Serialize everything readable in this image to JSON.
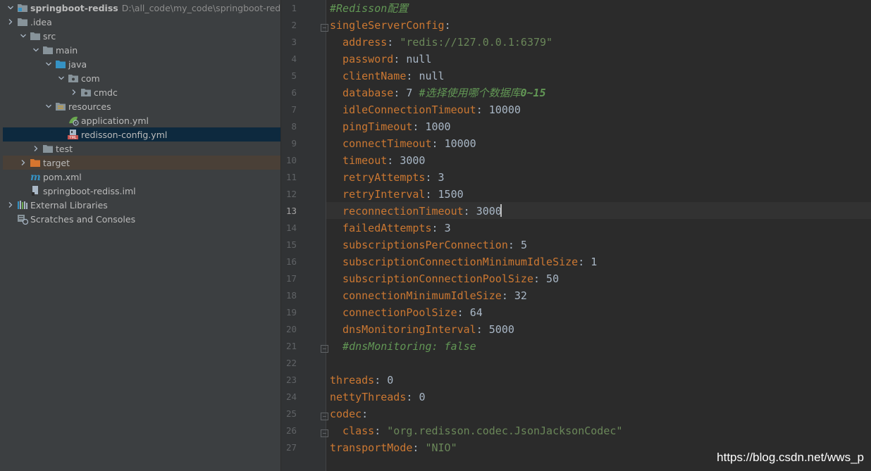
{
  "project_tree": {
    "root": {
      "label": "springboot-rediss",
      "path": "D:\\all_code\\my_code\\springboot-rediss"
    },
    "items": [
      {
        "label": ".idea",
        "icon": "folder-icon",
        "arrow": "collapsed",
        "state": ""
      },
      {
        "label": "src",
        "icon": "folder-icon",
        "arrow": "expanded",
        "state": ""
      },
      {
        "label": "main",
        "icon": "folder-icon",
        "arrow": "expanded",
        "state": ""
      },
      {
        "label": "java",
        "icon": "source-folder-icon",
        "arrow": "expanded",
        "state": ""
      },
      {
        "label": "com",
        "icon": "package-icon",
        "arrow": "expanded",
        "state": ""
      },
      {
        "label": "cmdc",
        "icon": "package-icon",
        "arrow": "collapsed",
        "state": ""
      },
      {
        "label": "resources",
        "icon": "resources-folder-icon",
        "arrow": "expanded",
        "state": ""
      },
      {
        "label": "application.yml",
        "icon": "spring-yml-icon",
        "arrow": "",
        "state": ""
      },
      {
        "label": "redisson-config.yml",
        "icon": "yml-file-icon",
        "arrow": "",
        "state": "selected"
      },
      {
        "label": "test",
        "icon": "folder-icon",
        "arrow": "collapsed",
        "state": ""
      },
      {
        "label": "target",
        "icon": "excluded-folder-icon",
        "arrow": "collapsed",
        "state": "excluded"
      },
      {
        "label": "pom.xml",
        "icon": "maven-icon",
        "arrow": "",
        "state": ""
      },
      {
        "label": "springboot-rediss.iml",
        "icon": "iml-file-icon",
        "arrow": "",
        "state": ""
      },
      {
        "label": "External Libraries",
        "icon": "libraries-icon",
        "arrow": "collapsed",
        "state": ""
      },
      {
        "label": "Scratches and Consoles",
        "icon": "scratches-icon",
        "arrow": "",
        "state": ""
      }
    ]
  },
  "editor": {
    "current_line": 13,
    "lines": [
      {
        "n": "1",
        "parts": [
          {
            "t": "#Redisson配置",
            "c": "c"
          }
        ]
      },
      {
        "n": "2",
        "parts": [
          {
            "t": "singleServerConfig",
            "c": "k"
          },
          {
            "t": ":",
            "c": "p"
          }
        ]
      },
      {
        "n": "3",
        "parts": [
          {
            "t": "  address",
            "c": "k"
          },
          {
            "t": ": ",
            "c": "p"
          },
          {
            "t": "\"redis://127.0.0.1:6379\"",
            "c": "s"
          }
        ]
      },
      {
        "n": "4",
        "parts": [
          {
            "t": "  password",
            "c": "k"
          },
          {
            "t": ": ",
            "c": "p"
          },
          {
            "t": "null",
            "c": "v"
          }
        ]
      },
      {
        "n": "5",
        "parts": [
          {
            "t": "  clientName",
            "c": "k"
          },
          {
            "t": ": ",
            "c": "p"
          },
          {
            "t": "null",
            "c": "v"
          }
        ]
      },
      {
        "n": "6",
        "parts": [
          {
            "t": "  database",
            "c": "k"
          },
          {
            "t": ": ",
            "c": "p"
          },
          {
            "t": "7 ",
            "c": "v"
          },
          {
            "t": "#选择使用哪个数据库",
            "c": "c"
          },
          {
            "t": "0~15",
            "c": "cb"
          }
        ]
      },
      {
        "n": "7",
        "parts": [
          {
            "t": "  idleConnectionTimeout",
            "c": "k"
          },
          {
            "t": ": ",
            "c": "p"
          },
          {
            "t": "10000",
            "c": "v"
          }
        ]
      },
      {
        "n": "8",
        "parts": [
          {
            "t": "  pingTimeout",
            "c": "k"
          },
          {
            "t": ": ",
            "c": "p"
          },
          {
            "t": "1000",
            "c": "v"
          }
        ]
      },
      {
        "n": "9",
        "parts": [
          {
            "t": "  connectTimeout",
            "c": "k"
          },
          {
            "t": ": ",
            "c": "p"
          },
          {
            "t": "10000",
            "c": "v"
          }
        ]
      },
      {
        "n": "10",
        "parts": [
          {
            "t": "  timeout",
            "c": "k"
          },
          {
            "t": ": ",
            "c": "p"
          },
          {
            "t": "3000",
            "c": "v"
          }
        ]
      },
      {
        "n": "11",
        "parts": [
          {
            "t": "  retryAttempts",
            "c": "k"
          },
          {
            "t": ": ",
            "c": "p"
          },
          {
            "t": "3",
            "c": "v"
          }
        ]
      },
      {
        "n": "12",
        "parts": [
          {
            "t": "  retryInterval",
            "c": "k"
          },
          {
            "t": ": ",
            "c": "p"
          },
          {
            "t": "1500",
            "c": "v"
          }
        ]
      },
      {
        "n": "13",
        "parts": [
          {
            "t": "  reconnectionTimeout",
            "c": "k"
          },
          {
            "t": ": ",
            "c": "p"
          },
          {
            "t": "3000",
            "c": "v"
          }
        ]
      },
      {
        "n": "14",
        "parts": [
          {
            "t": "  failedAttempts",
            "c": "k"
          },
          {
            "t": ": ",
            "c": "p"
          },
          {
            "t": "3",
            "c": "v"
          }
        ]
      },
      {
        "n": "15",
        "parts": [
          {
            "t": "  subscriptionsPerConnection",
            "c": "k"
          },
          {
            "t": ": ",
            "c": "p"
          },
          {
            "t": "5",
            "c": "v"
          }
        ]
      },
      {
        "n": "16",
        "parts": [
          {
            "t": "  subscriptionConnectionMinimumIdleSize",
            "c": "k"
          },
          {
            "t": ": ",
            "c": "p"
          },
          {
            "t": "1",
            "c": "v"
          }
        ]
      },
      {
        "n": "17",
        "parts": [
          {
            "t": "  subscriptionConnectionPoolSize",
            "c": "k"
          },
          {
            "t": ": ",
            "c": "p"
          },
          {
            "t": "50",
            "c": "v"
          }
        ]
      },
      {
        "n": "18",
        "parts": [
          {
            "t": "  connectionMinimumIdleSize",
            "c": "k"
          },
          {
            "t": ": ",
            "c": "p"
          },
          {
            "t": "32",
            "c": "v"
          }
        ]
      },
      {
        "n": "19",
        "parts": [
          {
            "t": "  connectionPoolSize",
            "c": "k"
          },
          {
            "t": ": ",
            "c": "p"
          },
          {
            "t": "64",
            "c": "v"
          }
        ]
      },
      {
        "n": "20",
        "parts": [
          {
            "t": "  dnsMonitoringInterval",
            "c": "k"
          },
          {
            "t": ": ",
            "c": "p"
          },
          {
            "t": "5000",
            "c": "v"
          }
        ]
      },
      {
        "n": "21",
        "parts": [
          {
            "t": "  #dnsMonitoring: false",
            "c": "c"
          }
        ]
      },
      {
        "n": "22",
        "parts": []
      },
      {
        "n": "23",
        "parts": [
          {
            "t": "threads",
            "c": "k"
          },
          {
            "t": ": ",
            "c": "p"
          },
          {
            "t": "0",
            "c": "v"
          }
        ]
      },
      {
        "n": "24",
        "parts": [
          {
            "t": "nettyThreads",
            "c": "k"
          },
          {
            "t": ": ",
            "c": "p"
          },
          {
            "t": "0",
            "c": "v"
          }
        ]
      },
      {
        "n": "25",
        "parts": [
          {
            "t": "codec",
            "c": "k"
          },
          {
            "t": ":",
            "c": "p"
          }
        ]
      },
      {
        "n": "26",
        "parts": [
          {
            "t": "  class",
            "c": "k"
          },
          {
            "t": ": ",
            "c": "p"
          },
          {
            "t": "\"org.redisson.codec.JsonJacksonCodec\"",
            "c": "s"
          }
        ]
      },
      {
        "n": "27",
        "parts": [
          {
            "t": "transportMode",
            "c": "k"
          },
          {
            "t": ": ",
            "c": "p"
          },
          {
            "t": "\"NIO\"",
            "c": "s"
          }
        ]
      }
    ],
    "fold_lines": [
      2,
      21,
      25,
      26
    ]
  },
  "watermark": "https://blog.csdn.net/wws_p",
  "colors": {
    "keyword": "#cc7832",
    "string": "#6a8759",
    "comment": "#629755",
    "text": "#a9b7c6",
    "selection": "#0d293e",
    "excluded": "#4a4037"
  }
}
